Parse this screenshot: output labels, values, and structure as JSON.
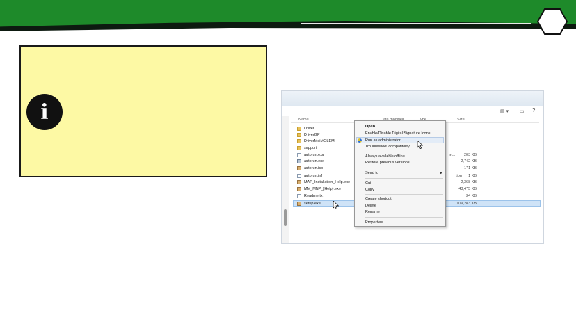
{
  "explorer": {
    "columns": [
      "Name",
      "Date modified",
      "Type",
      "Size"
    ],
    "files": [
      {
        "name": "Driver",
        "icon": "folder-icon",
        "size": ""
      },
      {
        "name": "DriverGP",
        "icon": "folder-icon",
        "size": ""
      },
      {
        "name": "DriverMeiMOLEM",
        "icon": "folder-icon",
        "size": ""
      },
      {
        "name": "support",
        "icon": "folder-icon",
        "size": ""
      },
      {
        "name": "autorun.exu",
        "icon": "doc-icon",
        "size": "203 KB"
      },
      {
        "name": "autorun.exe",
        "icon": "exe-icon",
        "size": "2,742 KB"
      },
      {
        "name": "autorun.ico",
        "icon": "app-icon",
        "size": "171 KB"
      },
      {
        "name": "autorun.inf",
        "icon": "doc-icon",
        "size": "1 KB"
      },
      {
        "name": "MAP_Installation_Help.exe",
        "icon": "app-icon",
        "size": "2,368 KB"
      },
      {
        "name": "MM_MNP_(Help).exe",
        "icon": "app-icon",
        "size": "43,475 KB"
      },
      {
        "name": "Readme.txt",
        "icon": "doc-icon",
        "size": "34 KB"
      },
      {
        "name": "setup.exe",
        "icon": "app-icon",
        "size": "109,283 KB"
      }
    ],
    "type_fragments": [
      "te...",
      "tion"
    ]
  },
  "context_menu": {
    "items": [
      {
        "label": "Open",
        "bold": true
      },
      {
        "label": "Enable/Disable Digital Signature Icons"
      },
      {
        "label": "Run as administrator",
        "highlighted": true
      },
      {
        "label": "Troubleshoot compatibility"
      },
      {
        "label": "Always available offline"
      },
      {
        "label": "Restore previous versions"
      },
      {
        "label": "Send to",
        "submenu": true
      },
      {
        "label": "Cut"
      },
      {
        "label": "Copy"
      },
      {
        "label": "Create shortcut"
      },
      {
        "label": "Delete"
      },
      {
        "label": "Rename"
      },
      {
        "label": "Properties"
      }
    ]
  },
  "colors": {
    "header_green": "#1e8a2a",
    "note_bg": "#fdf9a4",
    "icon_circle": "#111111"
  },
  "icons": {
    "info": "i"
  }
}
